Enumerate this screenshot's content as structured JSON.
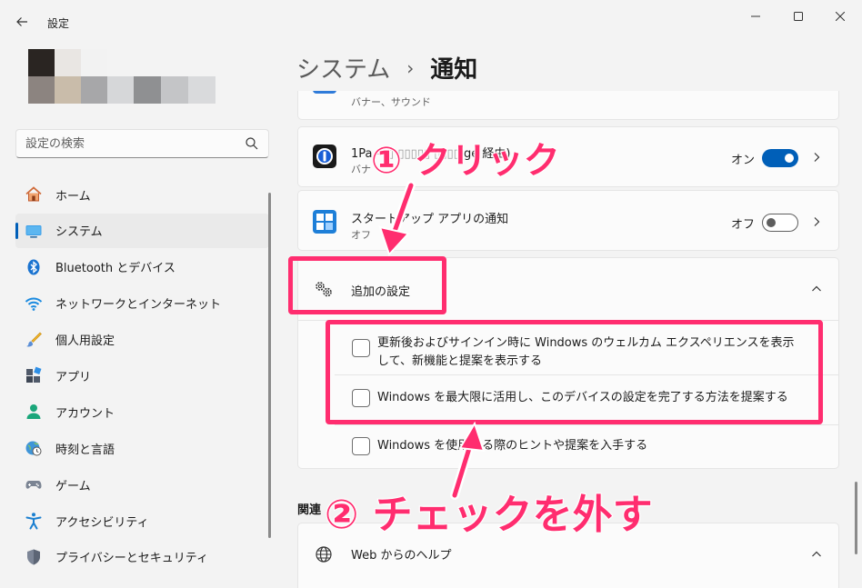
{
  "window": {
    "title": "設定",
    "back_icon": "arrow-left-icon"
  },
  "search": {
    "placeholder": "設定の検索"
  },
  "nav": [
    {
      "label": "ホーム",
      "icon": "home-icon"
    },
    {
      "label": "システム",
      "icon": "display-icon",
      "active": true
    },
    {
      "label": "Bluetooth とデバイス",
      "icon": "bluetooth-icon"
    },
    {
      "label": "ネットワークとインターネット",
      "icon": "wifi-icon"
    },
    {
      "label": "個人用設定",
      "icon": "brush-icon"
    },
    {
      "label": "アプリ",
      "icon": "apps-icon"
    },
    {
      "label": "アカウント",
      "icon": "person-icon"
    },
    {
      "label": "時刻と言語",
      "icon": "clock-globe-icon"
    },
    {
      "label": "ゲーム",
      "icon": "gamepad-icon"
    },
    {
      "label": "アクセシビリティ",
      "icon": "accessibility-icon"
    },
    {
      "label": "プライバシーとセキュリティ",
      "icon": "shield-icon"
    }
  ],
  "breadcrumb": {
    "parent": "システム",
    "separator": "›",
    "current": "通知"
  },
  "rows": {
    "partial_sub": "バナー、サウンド",
    "onepass_title": "1Pa",
    "onepass_title_tail": "ge 経由)",
    "onepass_sub": "バナ",
    "onepass_toggle": "オン",
    "startup_title": "スタートアップ アプリの通知",
    "startup_sub": "オフ",
    "startup_toggle": "オフ",
    "additional_title": "追加の設定"
  },
  "checkboxes": {
    "welcome": "更新後およびサインイン時に Windows のウェルカム エクスペリエンスを表示して、新機能と提案を表示する",
    "finish_setup": "Windows を最大限に活用し、このデバイスの設定を完了する方法を提案する",
    "tips_a": "Windows を使用",
    "tips_b": "る際のヒントや提案を入手する"
  },
  "related": {
    "label": "関連",
    "help_title": "Web からのヘルプ"
  },
  "annotations": {
    "step1": "① クリック",
    "step2": "② チェックを外す",
    "color": "#ff2d6f"
  },
  "colors": {
    "accent": "#005fb8"
  }
}
